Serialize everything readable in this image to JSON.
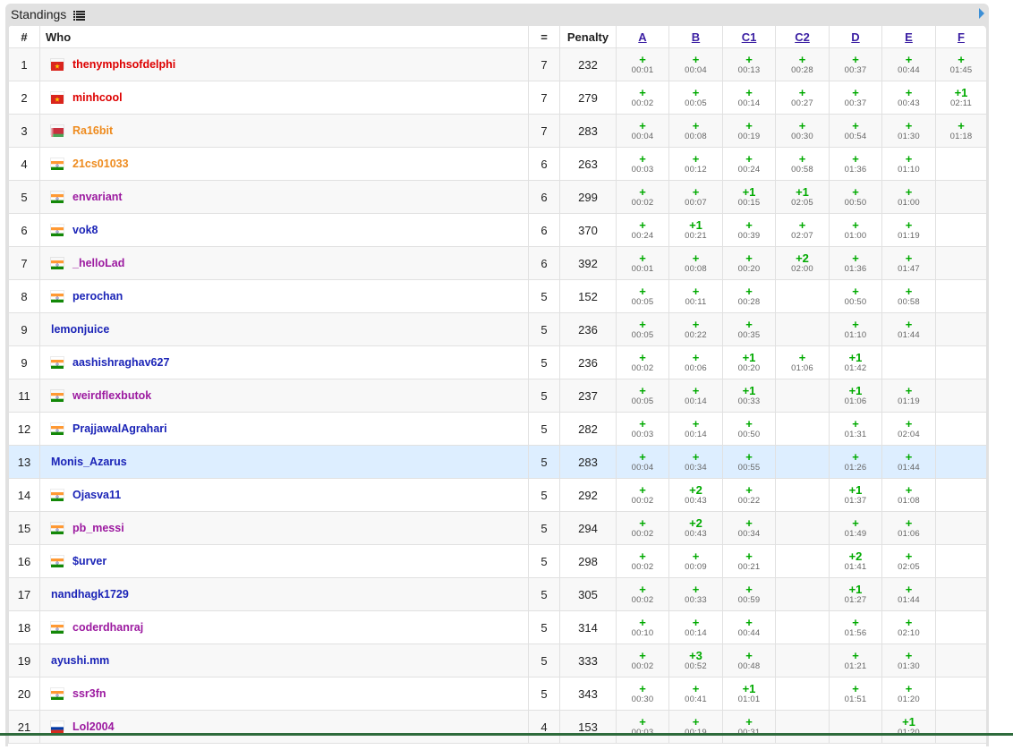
{
  "header": {
    "title": "Standings"
  },
  "colors": {
    "red": "#dd0000",
    "orange": "#ee8b1e",
    "purple": "#9c1aa0",
    "blue": "#1b24b7",
    "accepted": "#00aa00",
    "highlight_row": "#ddeeff"
  },
  "columns": {
    "rank": "#",
    "who": "Who",
    "solved": "=",
    "penalty": "Penalty",
    "problems": [
      "A",
      "B",
      "C1",
      "C2",
      "D",
      "E",
      "F"
    ]
  },
  "rows": [
    {
      "rank": "1",
      "handle": "thenymphsofdelphi",
      "color": "red",
      "flag": "vn",
      "solved": "7",
      "penalty": "232",
      "cells": [
        [
          "+",
          "00:01"
        ],
        [
          "+",
          "00:04"
        ],
        [
          "+",
          "00:13"
        ],
        [
          "+",
          "00:28"
        ],
        [
          "+",
          "00:37"
        ],
        [
          "+",
          "00:44"
        ],
        [
          "+",
          "01:45"
        ]
      ]
    },
    {
      "rank": "2",
      "handle": "minhcool",
      "color": "red",
      "flag": "vn",
      "solved": "7",
      "penalty": "279",
      "cells": [
        [
          "+",
          "00:02"
        ],
        [
          "+",
          "00:05"
        ],
        [
          "+",
          "00:14"
        ],
        [
          "+",
          "00:27"
        ],
        [
          "+",
          "00:37"
        ],
        [
          "+",
          "00:43"
        ],
        [
          "+1",
          "02:11"
        ]
      ]
    },
    {
      "rank": "3",
      "handle": "Ra16bit",
      "color": "orange",
      "flag": "by",
      "solved": "7",
      "penalty": "283",
      "cells": [
        [
          "+",
          "00:04"
        ],
        [
          "+",
          "00:08"
        ],
        [
          "+",
          "00:19"
        ],
        [
          "+",
          "00:30"
        ],
        [
          "+",
          "00:54"
        ],
        [
          "+",
          "01:30"
        ],
        [
          "+",
          "01:18"
        ]
      ]
    },
    {
      "rank": "4",
      "handle": "21cs01033",
      "color": "orange",
      "flag": "in",
      "solved": "6",
      "penalty": "263",
      "cells": [
        [
          "+",
          "00:03"
        ],
        [
          "+",
          "00:12"
        ],
        [
          "+",
          "00:24"
        ],
        [
          "+",
          "00:58"
        ],
        [
          "+",
          "01:36"
        ],
        [
          "+",
          "01:10"
        ],
        null
      ]
    },
    {
      "rank": "5",
      "handle": "envariant",
      "color": "purple",
      "flag": "in",
      "solved": "6",
      "penalty": "299",
      "cells": [
        [
          "+",
          "00:02"
        ],
        [
          "+",
          "00:07"
        ],
        [
          "+1",
          "00:15"
        ],
        [
          "+1",
          "02:05"
        ],
        [
          "+",
          "00:50"
        ],
        [
          "+",
          "01:00"
        ],
        null
      ]
    },
    {
      "rank": "6",
      "handle": "vok8",
      "color": "blue",
      "flag": "in",
      "solved": "6",
      "penalty": "370",
      "cells": [
        [
          "+",
          "00:24"
        ],
        [
          "+1",
          "00:21"
        ],
        [
          "+",
          "00:39"
        ],
        [
          "+",
          "02:07"
        ],
        [
          "+",
          "01:00"
        ],
        [
          "+",
          "01:19"
        ],
        null
      ]
    },
    {
      "rank": "7",
      "handle": "_helloLad",
      "color": "purple",
      "flag": "in",
      "solved": "6",
      "penalty": "392",
      "cells": [
        [
          "+",
          "00:01"
        ],
        [
          "+",
          "00:08"
        ],
        [
          "+",
          "00:20"
        ],
        [
          "+2",
          "02:00"
        ],
        [
          "+",
          "01:36"
        ],
        [
          "+",
          "01:47"
        ],
        null
      ]
    },
    {
      "rank": "8",
      "handle": "perochan",
      "color": "blue",
      "flag": "in",
      "solved": "5",
      "penalty": "152",
      "cells": [
        [
          "+",
          "00:05"
        ],
        [
          "+",
          "00:11"
        ],
        [
          "+",
          "00:28"
        ],
        null,
        [
          "+",
          "00:50"
        ],
        [
          "+",
          "00:58"
        ],
        null
      ]
    },
    {
      "rank": "9",
      "handle": "lemonjuice",
      "color": "blue",
      "flag": "",
      "solved": "5",
      "penalty": "236",
      "cells": [
        [
          "+",
          "00:05"
        ],
        [
          "+",
          "00:22"
        ],
        [
          "+",
          "00:35"
        ],
        null,
        [
          "+",
          "01:10"
        ],
        [
          "+",
          "01:44"
        ],
        null
      ]
    },
    {
      "rank": "9",
      "handle": "aashishraghav627",
      "color": "blue",
      "flag": "in",
      "solved": "5",
      "penalty": "236",
      "cells": [
        [
          "+",
          "00:02"
        ],
        [
          "+",
          "00:06"
        ],
        [
          "+1",
          "00:20"
        ],
        [
          "+",
          "01:06"
        ],
        [
          "+1",
          "01:42"
        ],
        null,
        null
      ]
    },
    {
      "rank": "11",
      "handle": "weirdflexbutok",
      "color": "purple",
      "flag": "in",
      "solved": "5",
      "penalty": "237",
      "cells": [
        [
          "+",
          "00:05"
        ],
        [
          "+",
          "00:14"
        ],
        [
          "+1",
          "00:33"
        ],
        null,
        [
          "+1",
          "01:06"
        ],
        [
          "+",
          "01:19"
        ],
        null
      ]
    },
    {
      "rank": "12",
      "handle": "PrajjawalAgrahari",
      "color": "blue",
      "flag": "in",
      "solved": "5",
      "penalty": "282",
      "cells": [
        [
          "+",
          "00:03"
        ],
        [
          "+",
          "00:14"
        ],
        [
          "+",
          "00:50"
        ],
        null,
        [
          "+",
          "01:31"
        ],
        [
          "+",
          "02:04"
        ],
        null
      ]
    },
    {
      "rank": "13",
      "handle": "Monis_Azarus",
      "color": "blue",
      "flag": "",
      "solved": "5",
      "penalty": "283",
      "highlight": true,
      "cells": [
        [
          "+",
          "00:04"
        ],
        [
          "+",
          "00:34"
        ],
        [
          "+",
          "00:55"
        ],
        null,
        [
          "+",
          "01:26"
        ],
        [
          "+",
          "01:44"
        ],
        null
      ]
    },
    {
      "rank": "14",
      "handle": "Ojasva11",
      "color": "blue",
      "flag": "in",
      "solved": "5",
      "penalty": "292",
      "cells": [
        [
          "+",
          "00:02"
        ],
        [
          "+2",
          "00:43"
        ],
        [
          "+",
          "00:22"
        ],
        null,
        [
          "+1",
          "01:37"
        ],
        [
          "+",
          "01:08"
        ],
        null
      ]
    },
    {
      "rank": "15",
      "handle": "pb_messi",
      "color": "purple",
      "flag": "in",
      "solved": "5",
      "penalty": "294",
      "cells": [
        [
          "+",
          "00:02"
        ],
        [
          "+2",
          "00:43"
        ],
        [
          "+",
          "00:34"
        ],
        null,
        [
          "+",
          "01:49"
        ],
        [
          "+",
          "01:06"
        ],
        null
      ]
    },
    {
      "rank": "16",
      "handle": "$urver",
      "color": "blue",
      "flag": "in",
      "solved": "5",
      "penalty": "298",
      "cells": [
        [
          "+",
          "00:02"
        ],
        [
          "+",
          "00:09"
        ],
        [
          "+",
          "00:21"
        ],
        null,
        [
          "+2",
          "01:41"
        ],
        [
          "+",
          "02:05"
        ],
        null
      ]
    },
    {
      "rank": "17",
      "handle": "nandhagk1729",
      "color": "blue",
      "flag": "",
      "solved": "5",
      "penalty": "305",
      "cells": [
        [
          "+",
          "00:02"
        ],
        [
          "+",
          "00:33"
        ],
        [
          "+",
          "00:59"
        ],
        null,
        [
          "+1",
          "01:27"
        ],
        [
          "+",
          "01:44"
        ],
        null
      ]
    },
    {
      "rank": "18",
      "handle": "coderdhanraj",
      "color": "purple",
      "flag": "in",
      "solved": "5",
      "penalty": "314",
      "cells": [
        [
          "+",
          "00:10"
        ],
        [
          "+",
          "00:14"
        ],
        [
          "+",
          "00:44"
        ],
        null,
        [
          "+",
          "01:56"
        ],
        [
          "+",
          "02:10"
        ],
        null
      ]
    },
    {
      "rank": "19",
      "handle": "ayushi.mm",
      "color": "blue",
      "flag": "",
      "solved": "5",
      "penalty": "333",
      "cells": [
        [
          "+",
          "00:02"
        ],
        [
          "+3",
          "00:52"
        ],
        [
          "+",
          "00:48"
        ],
        null,
        [
          "+",
          "01:21"
        ],
        [
          "+",
          "01:30"
        ],
        null
      ]
    },
    {
      "rank": "20",
      "handle": "ssr3fn",
      "color": "purple",
      "flag": "in",
      "solved": "5",
      "penalty": "343",
      "cells": [
        [
          "+",
          "00:30"
        ],
        [
          "+",
          "00:41"
        ],
        [
          "+1",
          "01:01"
        ],
        null,
        [
          "+",
          "01:51"
        ],
        [
          "+",
          "01:20"
        ],
        null
      ]
    },
    {
      "rank": "21",
      "handle": "Lol2004",
      "color": "purple",
      "flag": "ru",
      "solved": "4",
      "penalty": "153",
      "cells": [
        [
          "+",
          "00:03"
        ],
        [
          "+",
          "00:19"
        ],
        [
          "+",
          "00:31"
        ],
        null,
        null,
        [
          "+1",
          "01:20"
        ],
        null
      ]
    }
  ]
}
